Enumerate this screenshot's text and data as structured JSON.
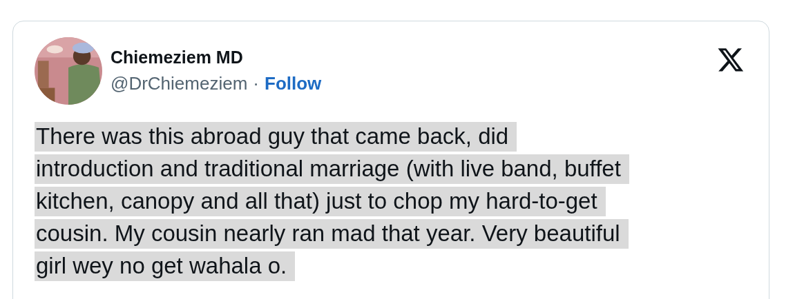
{
  "author": {
    "name": "Chiemeziem MD",
    "handle": "@DrChiemeziem",
    "separator": "·",
    "follow": "Follow"
  },
  "tweet": {
    "text_selected": true,
    "lines": [
      "There was this abroad guy that came back, did",
      "introduction and traditional marriage (with live band, buffet",
      "kitchen, canopy and all that) just to chop my hard-to-get",
      "cousin. My cousin nearly ran mad that year. Very beautiful",
      "girl wey no get wahala o."
    ]
  }
}
